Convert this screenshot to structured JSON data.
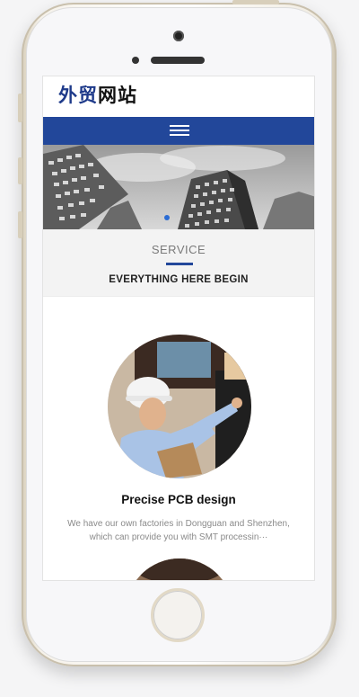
{
  "site": {
    "logo_part1": "外贸",
    "logo_part2": "网站"
  },
  "nav": {
    "menu_icon": "hamburger-menu-icon"
  },
  "banner": {
    "slide_count": 1,
    "active_slide": 1
  },
  "service": {
    "label": "SERVICE",
    "title": "EVERYTHING HERE BEGIN"
  },
  "cards": [
    {
      "title": "Precise PCB design",
      "description": "We have our own factories in Dongguan and Shenzhen, which can provide you with SMT processin···"
    }
  ],
  "colors": {
    "brand_blue": "#22479a",
    "logo_blue": "#1e3a8a",
    "accent_dot": "#2b6cd4"
  }
}
